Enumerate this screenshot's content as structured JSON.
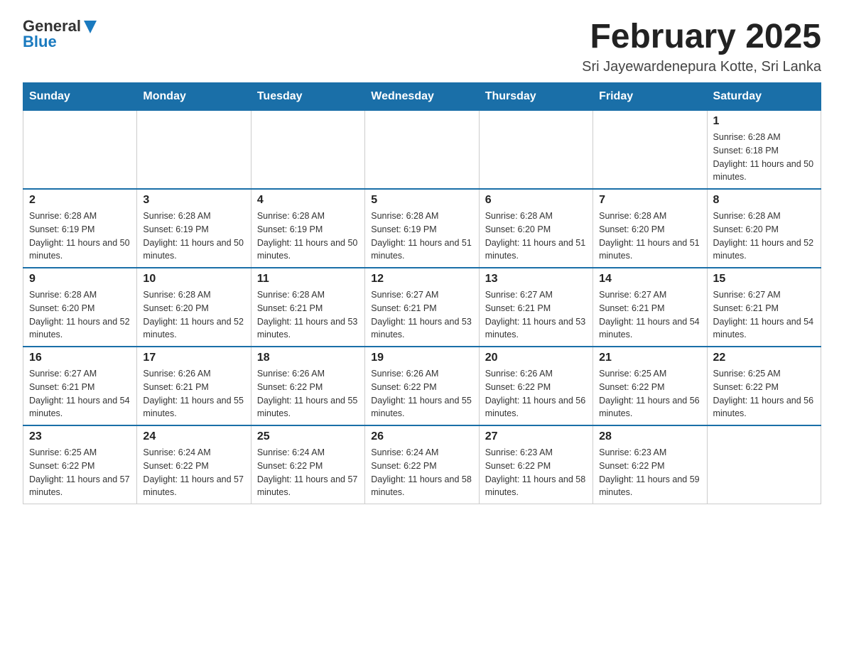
{
  "header": {
    "logo_general": "General",
    "logo_blue": "Blue",
    "main_title": "February 2025",
    "subtitle": "Sri Jayewardenepura Kotte, Sri Lanka"
  },
  "days_of_week": [
    "Sunday",
    "Monday",
    "Tuesday",
    "Wednesday",
    "Thursday",
    "Friday",
    "Saturday"
  ],
  "weeks": [
    {
      "days": [
        {
          "number": "",
          "info": ""
        },
        {
          "number": "",
          "info": ""
        },
        {
          "number": "",
          "info": ""
        },
        {
          "number": "",
          "info": ""
        },
        {
          "number": "",
          "info": ""
        },
        {
          "number": "",
          "info": ""
        },
        {
          "number": "1",
          "info": "Sunrise: 6:28 AM\nSunset: 6:18 PM\nDaylight: 11 hours and 50 minutes."
        }
      ]
    },
    {
      "days": [
        {
          "number": "2",
          "info": "Sunrise: 6:28 AM\nSunset: 6:19 PM\nDaylight: 11 hours and 50 minutes."
        },
        {
          "number": "3",
          "info": "Sunrise: 6:28 AM\nSunset: 6:19 PM\nDaylight: 11 hours and 50 minutes."
        },
        {
          "number": "4",
          "info": "Sunrise: 6:28 AM\nSunset: 6:19 PM\nDaylight: 11 hours and 50 minutes."
        },
        {
          "number": "5",
          "info": "Sunrise: 6:28 AM\nSunset: 6:19 PM\nDaylight: 11 hours and 51 minutes."
        },
        {
          "number": "6",
          "info": "Sunrise: 6:28 AM\nSunset: 6:20 PM\nDaylight: 11 hours and 51 minutes."
        },
        {
          "number": "7",
          "info": "Sunrise: 6:28 AM\nSunset: 6:20 PM\nDaylight: 11 hours and 51 minutes."
        },
        {
          "number": "8",
          "info": "Sunrise: 6:28 AM\nSunset: 6:20 PM\nDaylight: 11 hours and 52 minutes."
        }
      ]
    },
    {
      "days": [
        {
          "number": "9",
          "info": "Sunrise: 6:28 AM\nSunset: 6:20 PM\nDaylight: 11 hours and 52 minutes."
        },
        {
          "number": "10",
          "info": "Sunrise: 6:28 AM\nSunset: 6:20 PM\nDaylight: 11 hours and 52 minutes."
        },
        {
          "number": "11",
          "info": "Sunrise: 6:28 AM\nSunset: 6:21 PM\nDaylight: 11 hours and 53 minutes."
        },
        {
          "number": "12",
          "info": "Sunrise: 6:27 AM\nSunset: 6:21 PM\nDaylight: 11 hours and 53 minutes."
        },
        {
          "number": "13",
          "info": "Sunrise: 6:27 AM\nSunset: 6:21 PM\nDaylight: 11 hours and 53 minutes."
        },
        {
          "number": "14",
          "info": "Sunrise: 6:27 AM\nSunset: 6:21 PM\nDaylight: 11 hours and 54 minutes."
        },
        {
          "number": "15",
          "info": "Sunrise: 6:27 AM\nSunset: 6:21 PM\nDaylight: 11 hours and 54 minutes."
        }
      ]
    },
    {
      "days": [
        {
          "number": "16",
          "info": "Sunrise: 6:27 AM\nSunset: 6:21 PM\nDaylight: 11 hours and 54 minutes."
        },
        {
          "number": "17",
          "info": "Sunrise: 6:26 AM\nSunset: 6:21 PM\nDaylight: 11 hours and 55 minutes."
        },
        {
          "number": "18",
          "info": "Sunrise: 6:26 AM\nSunset: 6:22 PM\nDaylight: 11 hours and 55 minutes."
        },
        {
          "number": "19",
          "info": "Sunrise: 6:26 AM\nSunset: 6:22 PM\nDaylight: 11 hours and 55 minutes."
        },
        {
          "number": "20",
          "info": "Sunrise: 6:26 AM\nSunset: 6:22 PM\nDaylight: 11 hours and 56 minutes."
        },
        {
          "number": "21",
          "info": "Sunrise: 6:25 AM\nSunset: 6:22 PM\nDaylight: 11 hours and 56 minutes."
        },
        {
          "number": "22",
          "info": "Sunrise: 6:25 AM\nSunset: 6:22 PM\nDaylight: 11 hours and 56 minutes."
        }
      ]
    },
    {
      "days": [
        {
          "number": "23",
          "info": "Sunrise: 6:25 AM\nSunset: 6:22 PM\nDaylight: 11 hours and 57 minutes."
        },
        {
          "number": "24",
          "info": "Sunrise: 6:24 AM\nSunset: 6:22 PM\nDaylight: 11 hours and 57 minutes."
        },
        {
          "number": "25",
          "info": "Sunrise: 6:24 AM\nSunset: 6:22 PM\nDaylight: 11 hours and 57 minutes."
        },
        {
          "number": "26",
          "info": "Sunrise: 6:24 AM\nSunset: 6:22 PM\nDaylight: 11 hours and 58 minutes."
        },
        {
          "number": "27",
          "info": "Sunrise: 6:23 AM\nSunset: 6:22 PM\nDaylight: 11 hours and 58 minutes."
        },
        {
          "number": "28",
          "info": "Sunrise: 6:23 AM\nSunset: 6:22 PM\nDaylight: 11 hours and 59 minutes."
        },
        {
          "number": "",
          "info": ""
        }
      ]
    }
  ]
}
